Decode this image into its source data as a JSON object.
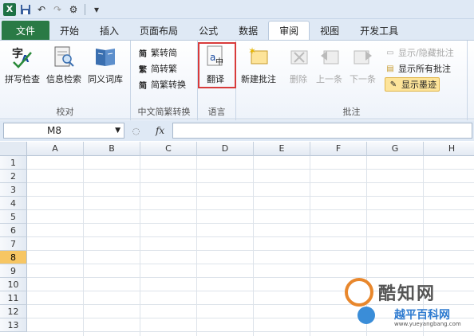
{
  "tabs": [
    {
      "label": "文件"
    },
    {
      "label": "开始"
    },
    {
      "label": "插入"
    },
    {
      "label": "页面布局"
    },
    {
      "label": "公式"
    },
    {
      "label": "数据"
    },
    {
      "label": "审阅"
    },
    {
      "label": "视图"
    },
    {
      "label": "开发工具"
    }
  ],
  "ribbon": {
    "proofing": {
      "label": "校对",
      "spell": "拼写检查",
      "research": "信息检索",
      "thesaurus": "同义词库"
    },
    "chinese": {
      "label": "中文简繁转换",
      "to_simplified": "繁转简",
      "to_traditional": "简转繁",
      "convert": "简繁转换"
    },
    "language": {
      "label": "语言",
      "translate": "翻译"
    },
    "comments": {
      "label": "批注",
      "new": "新建批注",
      "delete": "删除",
      "prev": "上一条",
      "next": "下一条",
      "show_hide": "显示/隐藏批注",
      "show_all": "显示所有批注",
      "show_ink": "显示墨迹"
    }
  },
  "formula_bar": {
    "name_box": "M8",
    "fx": "fx",
    "formula": ""
  },
  "columns": [
    "A",
    "B",
    "C",
    "D",
    "E",
    "F",
    "G",
    "H"
  ],
  "rows": [
    "1",
    "2",
    "3",
    "4",
    "5",
    "6",
    "7",
    "8",
    "9",
    "10",
    "11",
    "12",
    "13"
  ],
  "selected_row": "8",
  "watermark": {
    "title": "酷知网",
    "subtitle": "越平百科网",
    "url": "www.yueyangbang.com"
  },
  "colors": {
    "file_tab": "#2a7a45",
    "highlight": "#fde49a",
    "red_box": "#d83b3b"
  }
}
